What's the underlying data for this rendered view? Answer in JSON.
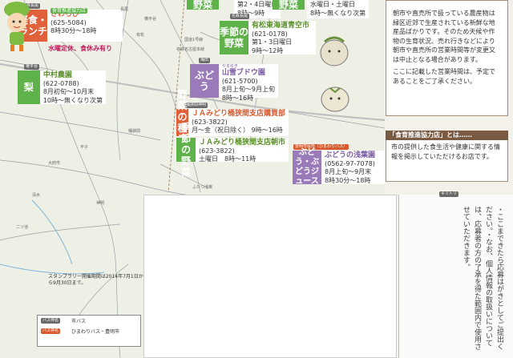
{
  "top_items": [
    {
      "name": "野菜",
      "lines": [
        ""
      ]
    },
    {
      "name": "野菜",
      "lines": [
        "水曜日・土曜日"
      ]
    },
    {
      "name": "",
      "lines": [
        "第2・4日曜日",
        "8時～9時"
      ]
    },
    {
      "name": "",
      "lines": [
        "8時～無くなり次第"
      ]
    }
  ],
  "shops": [
    {
      "tag": "名鉄長尾",
      "category": "軽食・ランチ",
      "name": "さわらび",
      "phone": "(625-5084)",
      "lines": [
        "8時30分～18時"
      ],
      "badge": "食育推進協力店"
    },
    {
      "tag": "名鉄長尾",
      "category": "季節の野菜",
      "name": "有松東海道青空市",
      "phone": "(621-0178)",
      "lines": [
        "第1・3日曜日",
        "9時～12時"
      ]
    },
    {
      "tag": "権平谷",
      "category": "梨",
      "name": "中村農園",
      "phone": "(622-0788)",
      "lines": [
        "8月初旬～10月末",
        "10時～無くなり次第"
      ]
    },
    {
      "tag": "梅田",
      "category": "ぶどう",
      "name": "山雪ブドウ園",
      "subtitle": "やまゆき",
      "phone": "(621-5700)",
      "lines": [
        "8月上旬～9月上旬",
        "8時～16時"
      ]
    },
    {
      "tag": "桶狭間神明",
      "category": "野菜の種子等",
      "name": "ＪＡみどり桶狭間支店購買部",
      "phone": "(623-3822)",
      "lines": [
        "月～金（祝日除く）",
        "9時～16時"
      ]
    },
    {
      "category": "季節の野菜",
      "name": "ＪＡみどり桶狭間支店朝市",
      "phone": "(623-3822)",
      "lines": [
        "土曜日　8時～11時"
      ]
    },
    {
      "tag": "豊明市役所（ひまわりバス）",
      "category": "ぶどう・ぶどうジュース",
      "name": "ぶどうの浅葉園",
      "phone": "(0562-97-7078)",
      "lines": [
        "8月上旬～9月末",
        "8時30分～18時"
      ]
    }
  ],
  "note_closed": "水曜定休、食休み有り",
  "roads": [
    "長尾",
    "横平谷",
    "国道1号線",
    "名鉄名古屋本線",
    "桶狭間",
    "大府市",
    "有松",
    "平子",
    "清水",
    "神明",
    "二ツ池",
    "ふたつ池東"
  ],
  "notice": {
    "para1": "朝市や直売所で扱っている農産物は緑区近郊で生産されている新鮮な地産品ばかりです。そのため天候や作物の生育状況、売れ行きなどにより朝市や直売所の営業時間等が変更又は中止となる場合があります。",
    "para2": "ここに記載した営業時間は、予定であることをご了承ください。"
  },
  "coop": {
    "title": "「食育推進協力店」とは……",
    "body": "市の提供した食生活や健康に関する情報を掲示していただけるお店です。"
  },
  "vertical": {
    "label": "キリトリ",
    "text": "・ここまできたら応募はがきとしてご提出ください。・なお、個人情報の取扱いについては、応募者の方の了承を得た範囲内で使用させていただきます。"
  },
  "stamp": "スタンプラリー開催期間は2014年7月1日から9月30日まで。",
  "legend": {
    "items": [
      {
        "badge": "バス停名",
        "label": "市バス"
      },
      {
        "badge": "バス停名",
        "label": "ひまわりバス・豊明市"
      }
    ]
  },
  "colors": {
    "red": "#e0603a",
    "green": "#5fb24a",
    "purple": "#9a7ab8",
    "brown": "#7a5a42"
  }
}
